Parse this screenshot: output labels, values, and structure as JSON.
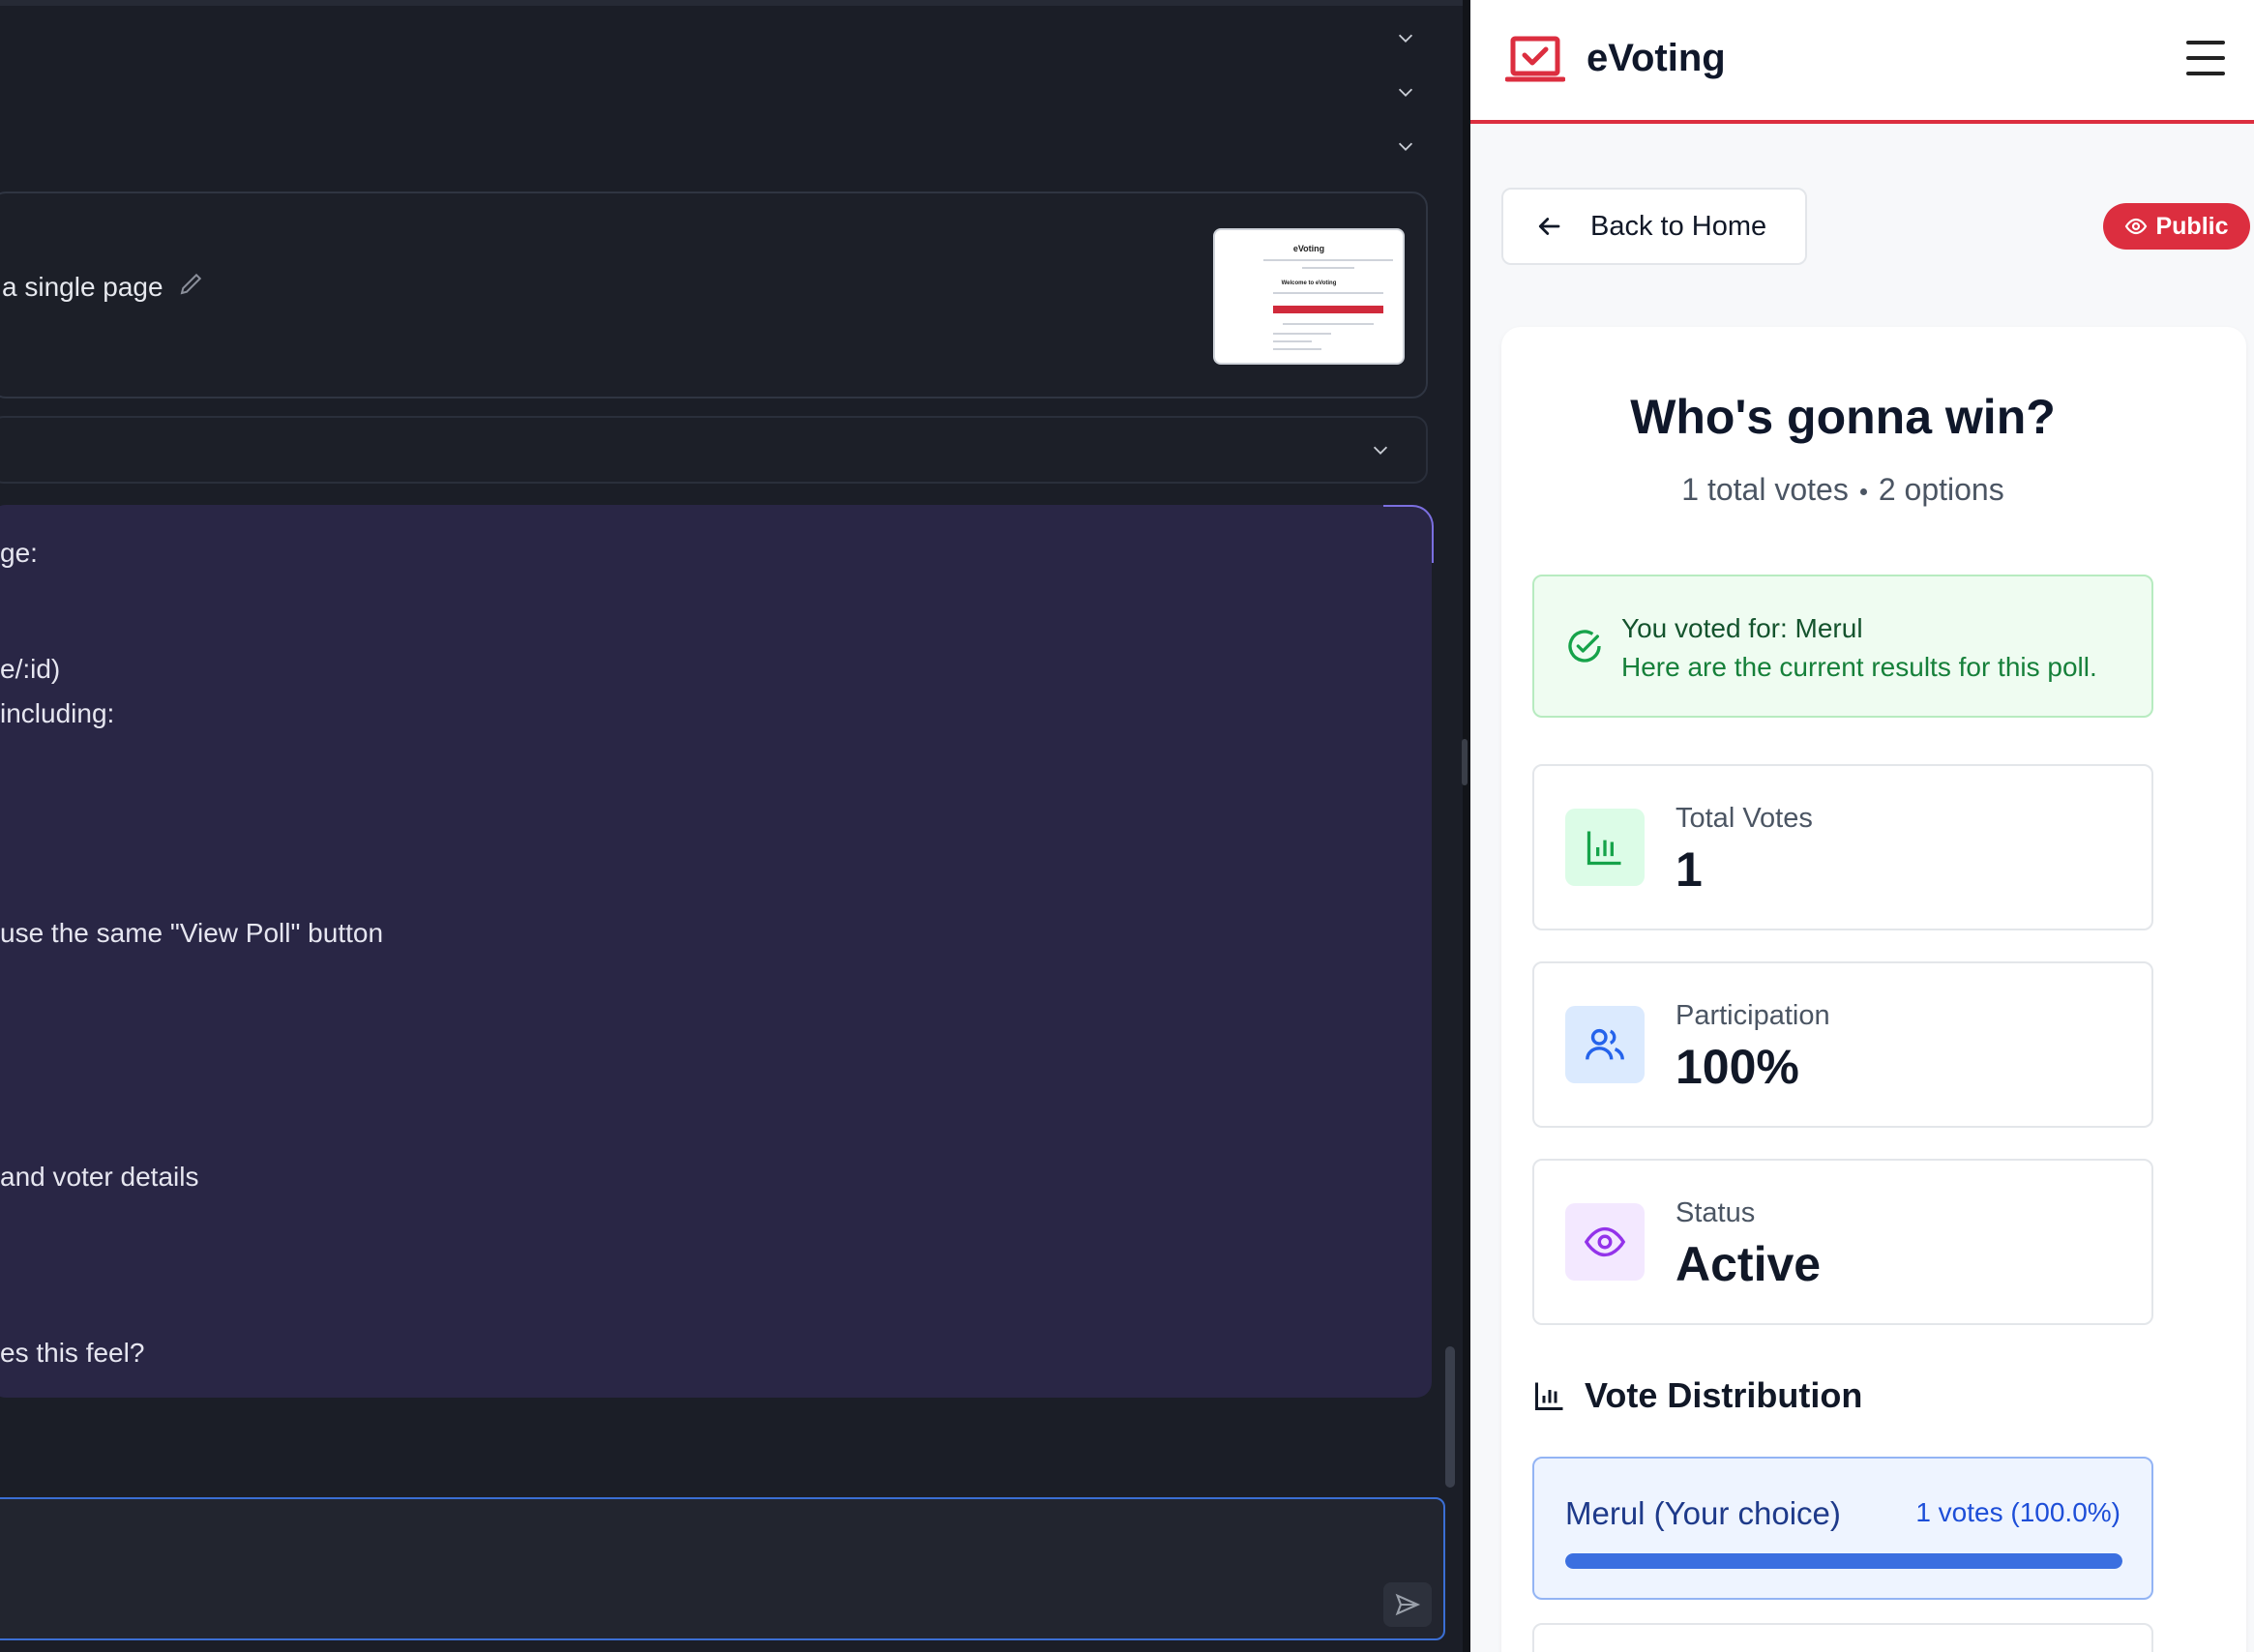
{
  "left_pane": {
    "attachment": {
      "title": "a single page",
      "thumbnail": {
        "title": "eVoting",
        "heading": "Welcome to eVoting"
      }
    },
    "message_lines": [
      "ge:",
      "e/:id)",
      "including:",
      "use the same \"View Poll\" button",
      "and voter details",
      "es this feel?"
    ]
  },
  "app": {
    "brand": "eVoting",
    "back_label": "Back to Home",
    "visibility_badge": "Public",
    "poll": {
      "title": "Who's gonna win?",
      "total_votes_text": "1 total votes",
      "options_text": "2 options"
    },
    "voted_banner": {
      "line1": "You voted for: Merul",
      "line2": "Here are the current results for this poll."
    },
    "stats": [
      {
        "label": "Total Votes",
        "value": "1",
        "icon": "bar-chart-icon",
        "color": "#16a34a",
        "bg": "#dcfce7"
      },
      {
        "label": "Participation",
        "value": "100%",
        "icon": "users-icon",
        "color": "#2563eb",
        "bg": "#dbeafe"
      },
      {
        "label": "Status",
        "value": "Active",
        "icon": "eye-icon",
        "color": "#9333ea",
        "bg": "#f3e8ff"
      }
    ],
    "distribution": {
      "heading": "Vote Distribution",
      "options": [
        {
          "name": "Merul (Your choice)",
          "count_text": "1 votes (100.0%)",
          "fraction": 1.0
        }
      ]
    }
  },
  "colors": {
    "accent": "#dc2e3f",
    "bar": "#3b6fe0",
    "success": "#16a34a"
  }
}
